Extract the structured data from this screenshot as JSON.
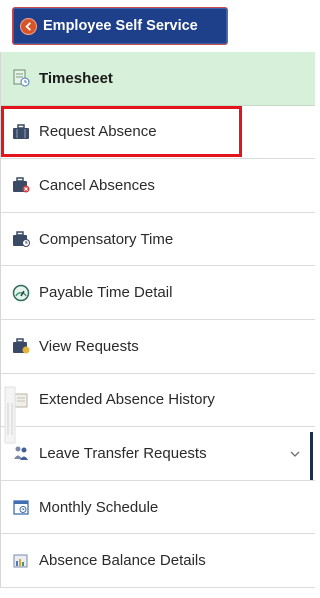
{
  "header": {
    "title": "Employee Self Service",
    "icon": "back-arrow-icon",
    "accent": "#1e3f8a",
    "back_color": "#d8552a"
  },
  "menu": {
    "header_item": {
      "label": "Timesheet",
      "icon": "timesheet-icon",
      "background": "#d7f0d9"
    },
    "items": [
      {
        "label": "Request Absence",
        "icon": "briefcase-icon",
        "highlighted": true
      },
      {
        "label": "Cancel Absences",
        "icon": "briefcase-cancel-icon"
      },
      {
        "label": "Compensatory Time",
        "icon": "briefcase-clock-icon"
      },
      {
        "label": "Payable Time Detail",
        "icon": "gauge-icon"
      },
      {
        "label": "View Requests",
        "icon": "briefcase-view-icon"
      },
      {
        "label": "Extended Absence History",
        "icon": "history-icon"
      },
      {
        "label": "Leave Transfer Requests",
        "icon": "people-transfer-icon",
        "expandable": true
      },
      {
        "label": "Monthly Schedule",
        "icon": "calendar-icon"
      },
      {
        "label": "Absence Balance Details",
        "icon": "balance-icon"
      }
    ]
  },
  "highlight_color": "#e3141b"
}
